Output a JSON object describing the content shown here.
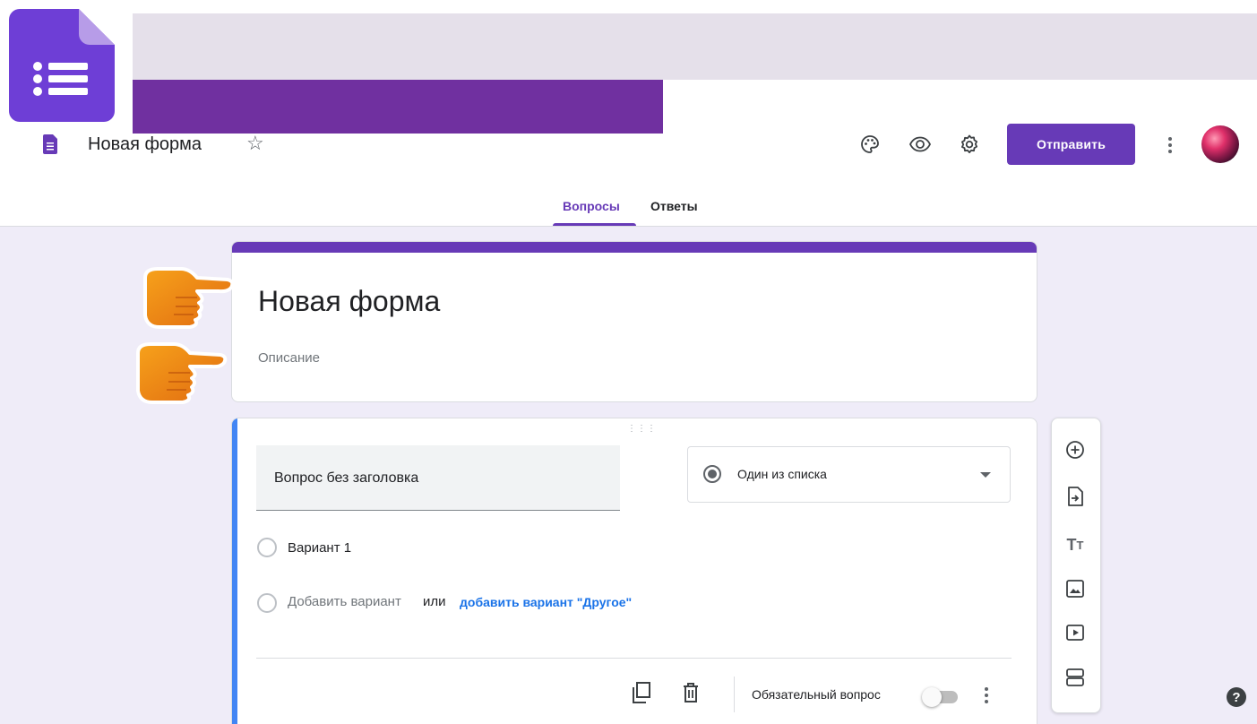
{
  "header": {
    "doc_title": "Новая форма",
    "send_label": "Отправить",
    "icons": [
      "forms-logo-icon",
      "star-icon",
      "palette-icon",
      "eye-icon",
      "settings-icon",
      "more-vert-icon",
      "avatar"
    ]
  },
  "tabs": [
    {
      "label": "Вопросы",
      "active": true
    },
    {
      "label": "Ответы",
      "active": false
    }
  ],
  "form": {
    "title": "Новая форма",
    "description_placeholder": "Описание"
  },
  "question": {
    "title": "Вопрос без заголовка",
    "type_label": "Один из списка",
    "options": [
      "Вариант 1"
    ],
    "add_option_label": "Добавить вариант",
    "or_label": "или",
    "add_other_label": "добавить вариант \"Другое\"",
    "required_label": "Обязательный вопрос",
    "required": false
  },
  "side_toolbar": [
    "add-question-icon",
    "import-questions-icon",
    "add-title-icon",
    "add-image-icon",
    "add-video-icon",
    "add-section-icon"
  ],
  "colors": {
    "accent": "#673ab7",
    "banner_purple": "#7030a0",
    "banner_light": "#e5e0ea",
    "canvas": "#efecf8",
    "focus_blue": "#4285f4",
    "link_blue": "#1a73e8"
  }
}
